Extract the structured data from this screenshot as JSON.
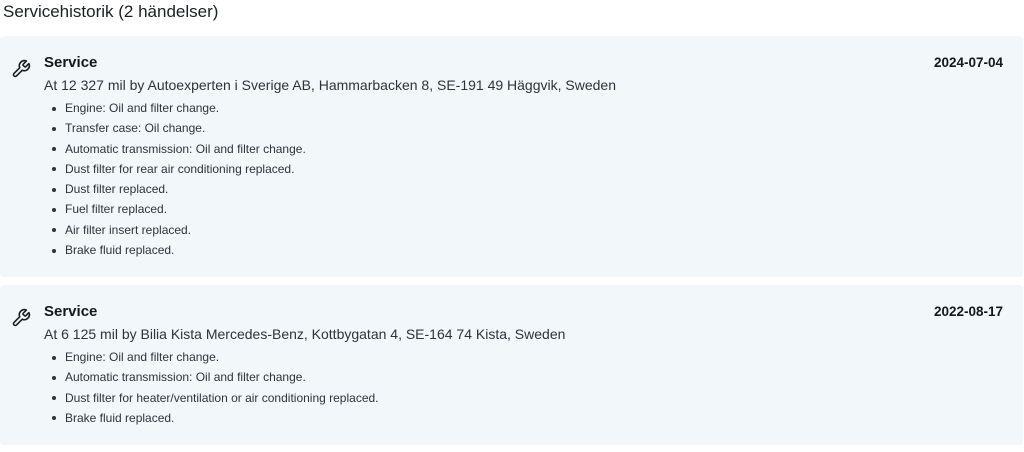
{
  "heading": "Servicehistorik (2 händelser)",
  "events": [
    {
      "icon": "wrench-icon",
      "title": "Service",
      "date": "2024-07-04",
      "description": "At 12 327 mil by Autoexperten i Sverige AB, Hammarbacken 8, SE-191 49 Häggvik, Sweden",
      "items": [
        "Engine: Oil and filter change.",
        "Transfer case: Oil change.",
        "Automatic transmission: Oil and filter change.",
        "Dust filter for rear air conditioning replaced.",
        "Dust filter replaced.",
        "Fuel filter replaced.",
        "Air filter insert replaced.",
        "Brake fluid replaced."
      ]
    },
    {
      "icon": "wrench-icon",
      "title": "Service",
      "date": "2022-08-17",
      "description": "At 6 125 mil by Bilia Kista Mercedes-Benz, Kottbygatan 4, SE-164 74 Kista, Sweden",
      "items": [
        "Engine: Oil and filter change.",
        "Automatic transmission: Oil and filter change.",
        "Dust filter for heater/ventilation or air conditioning replaced.",
        "Brake fluid replaced."
      ]
    }
  ]
}
